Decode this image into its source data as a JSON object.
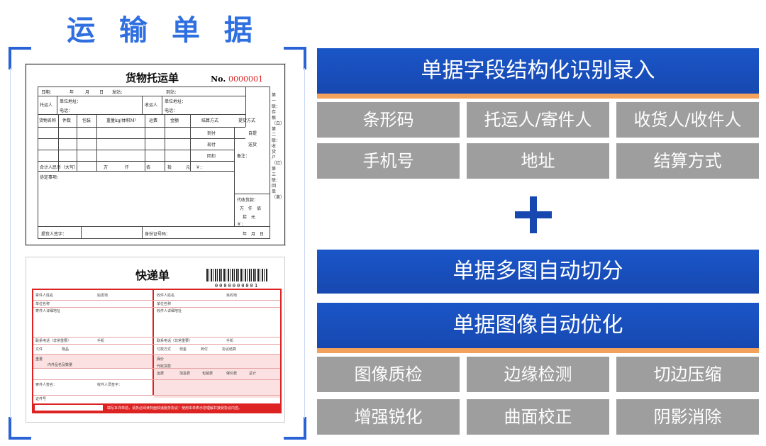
{
  "left": {
    "title": "运 输 单 据",
    "waybill": {
      "title": "货物托运单",
      "no_label": "No.",
      "no_value": "0000001",
      "fields": {
        "date": "日期：",
        "year": "年",
        "month": "月",
        "day": "日",
        "depart": "发站：",
        "arrive": "到站：",
        "shipper": "托运人",
        "unit_addr": "单位地址：",
        "phone": "电话：",
        "consignee": "收运人",
        "cargo_name": "货物名称",
        "pieces": "件数",
        "package": "包装",
        "weight": "重量kg/体积M³",
        "freight": "运费",
        "amount": "金额",
        "settle": "结算方式",
        "pickup": "提货方式",
        "arrive_pay": "到付",
        "self_pick": "自提",
        "cash_pay": "现付",
        "deliver": "送货",
        "return_pay": "回扣",
        "remark": "备注：",
        "total": "合计人民币（大写）：",
        "wan": "万",
        "qian": "仟",
        "bai": "佰",
        "shi": "拾",
        "yuan": "元",
        "yen": "￥：",
        "agreement": "协定事项：",
        "cod": "代收货款：",
        "cod_units": "万　仟　佰",
        "cod_units2": "拾　元",
        "pickup_sign": "提货人签字：",
        "id_no": "身份证号码：",
        "ym": "年　月　日"
      },
      "sidebar": "第一联：存根（白）第二联：收货户（红）第三联：回单（黄）"
    },
    "express": {
      "title": "快递单",
      "barcode_num": "0000000001",
      "sender_name": "寄件人姓名",
      "origin": "始发地",
      "sender_unit": "单位名称",
      "sender_addr": "寄件人详细地址",
      "receiver_name": "收件人姓名",
      "dest": "目的地",
      "receiver_unit": "单位名称",
      "receiver_addr": "收件人详细地址",
      "contact_phone": "联系电话（非常重要）",
      "mobile": "手机",
      "doc": "文件",
      "item": "物品",
      "weight": "重量",
      "items_qty": "内件品名及数量",
      "pay_method": "付款方式",
      "cash": "现金",
      "arrive_pay": "到付",
      "agreement_settle": "协议结算",
      "insure": "保价",
      "collect": "代收货款",
      "freight": "运费",
      "add_fee": "加急费",
      "pack_fee": "包装费",
      "insure_fee": "保价费",
      "total": "总计",
      "sender_sign": "寄件人签名：",
      "receiver_sign": "收件人员签字：",
      "cert_no": "证件号",
      "footer_text": "填写本详单前，请务必阅读背面快递服务协议！使用本单表示您理解并接受协议内容。"
    }
  },
  "right": {
    "header1": "单据字段结构化识别录入",
    "fields": [
      "条形码",
      "托运人/寄件人",
      "收货人/收件人",
      "手机号",
      "地址",
      "结算方式"
    ],
    "plus": "+",
    "header2": "单据多图自动切分",
    "header3": "单据图像自动优化",
    "opt": [
      "图像质检",
      "边缘检测",
      "切边压缩",
      "增强锐化",
      "曲面校正",
      "阴影消除"
    ]
  },
  "colors": {
    "title_blue": "#2f6fe0",
    "header_blue": "#1748b0",
    "accent_orange": "#f3a25b",
    "chip_gray": "#9e9e9e",
    "form_red": "#d22222"
  }
}
